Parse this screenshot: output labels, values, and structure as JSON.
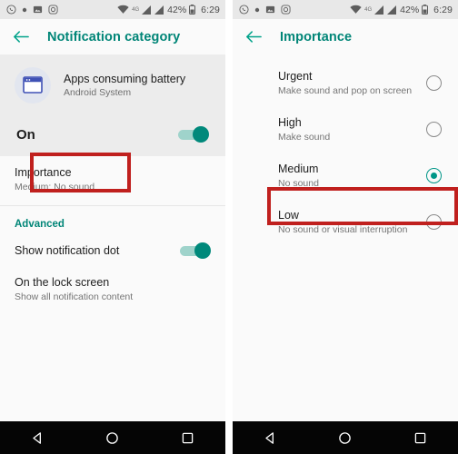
{
  "status_bar": {
    "notification_icons": [
      "whatsapp-icon",
      "dot-icon",
      "photo-icon",
      "instagram-icon"
    ],
    "wifi_icon": "wifi-icon",
    "network_label": "4G",
    "signal_icons": [
      "signal-bars-icon",
      "signal-bars-icon"
    ],
    "battery_percent": "42%",
    "battery_icon": "battery-icon",
    "time": "6:29"
  },
  "colors": {
    "accent_teal": "#008577",
    "switch_on": "#00897b",
    "radio_selected": "#009688",
    "annotation_red": "#c0201e"
  },
  "left_screen": {
    "appbar": {
      "back_icon": "arrow-back-icon",
      "title": "Notification category"
    },
    "app_header": {
      "icon": "android-system-app-icon",
      "title": "Apps consuming battery",
      "subtitle": "Android System"
    },
    "master_toggle": {
      "label": "On",
      "state": "on"
    },
    "importance_item": {
      "title": "Importance",
      "subtitle": "Medium: No sound",
      "highlighted": true
    },
    "advanced_section": {
      "label": "Advanced"
    },
    "notification_dot": {
      "label": "Show notification dot",
      "state": "on"
    },
    "lock_screen_item": {
      "title": "On the lock screen",
      "subtitle": "Show all notification content"
    }
  },
  "right_screen": {
    "appbar": {
      "back_icon": "arrow-back-icon",
      "title": "Importance"
    },
    "options": [
      {
        "title": "Urgent",
        "subtitle": "Make sound and pop on screen",
        "selected": false,
        "highlighted": false
      },
      {
        "title": "High",
        "subtitle": "Make sound",
        "selected": false,
        "highlighted": false
      },
      {
        "title": "Medium",
        "subtitle": "No sound",
        "selected": true,
        "highlighted": false
      },
      {
        "title": "Low",
        "subtitle": "No sound or visual interruption",
        "selected": false,
        "highlighted": true
      }
    ]
  },
  "nav_bar": {
    "back_label": "back-triangle-icon",
    "home_label": "home-circle-icon",
    "recents_label": "recents-square-icon"
  }
}
